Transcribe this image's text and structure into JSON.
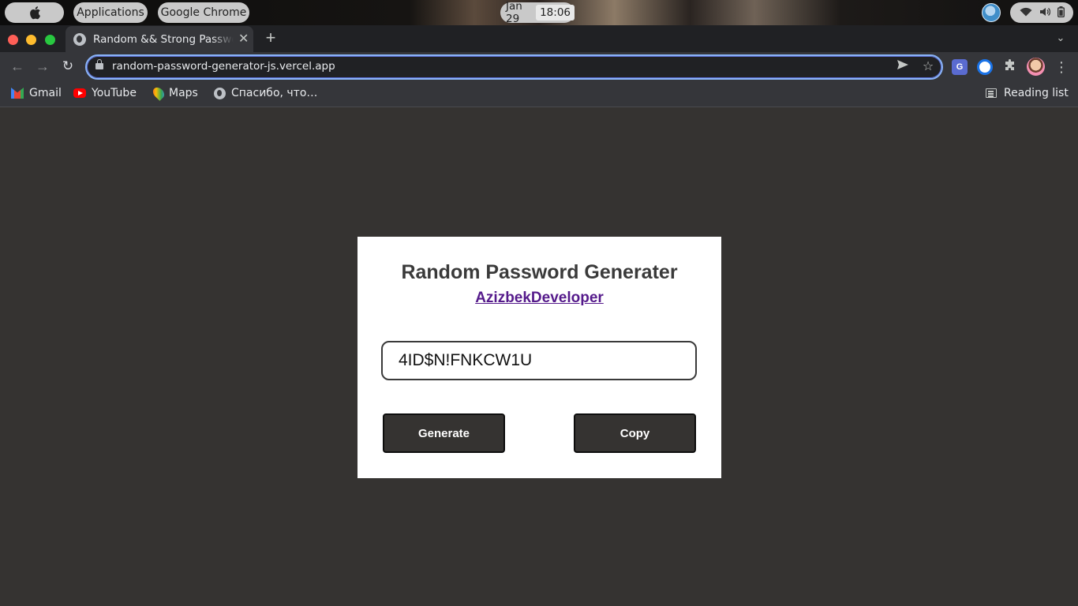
{
  "os_bar": {
    "apps_label": "Applications",
    "app_name": "Google Chrome",
    "date": "Jan 29",
    "time": "18:06"
  },
  "browser": {
    "tab_title": "Random && Strong Password Generator",
    "url": "random-password-generator-js.vercel.app",
    "bookmarks": [
      "Gmail",
      "YouTube",
      "Maps",
      "Спасибо, что…"
    ],
    "reading_list": "Reading list"
  },
  "page": {
    "title": "Random Password Generater",
    "author_link": "AzizbekDeveloper",
    "password_value": "4ID$N!FNKCW1U",
    "generate_label": "Generate",
    "copy_label": "Copy"
  },
  "colors": {
    "page_background": "#353331",
    "card_background": "#ffffff",
    "button_background": "#353331",
    "link_color": "#551a8b",
    "omnibox_focus": "#8ab4f8"
  },
  "icons": {
    "apple": "apple-icon",
    "reload": "reload-icon",
    "star": "bookmark-star-icon",
    "send": "send-icon",
    "extensions": "puzzle-icon"
  }
}
